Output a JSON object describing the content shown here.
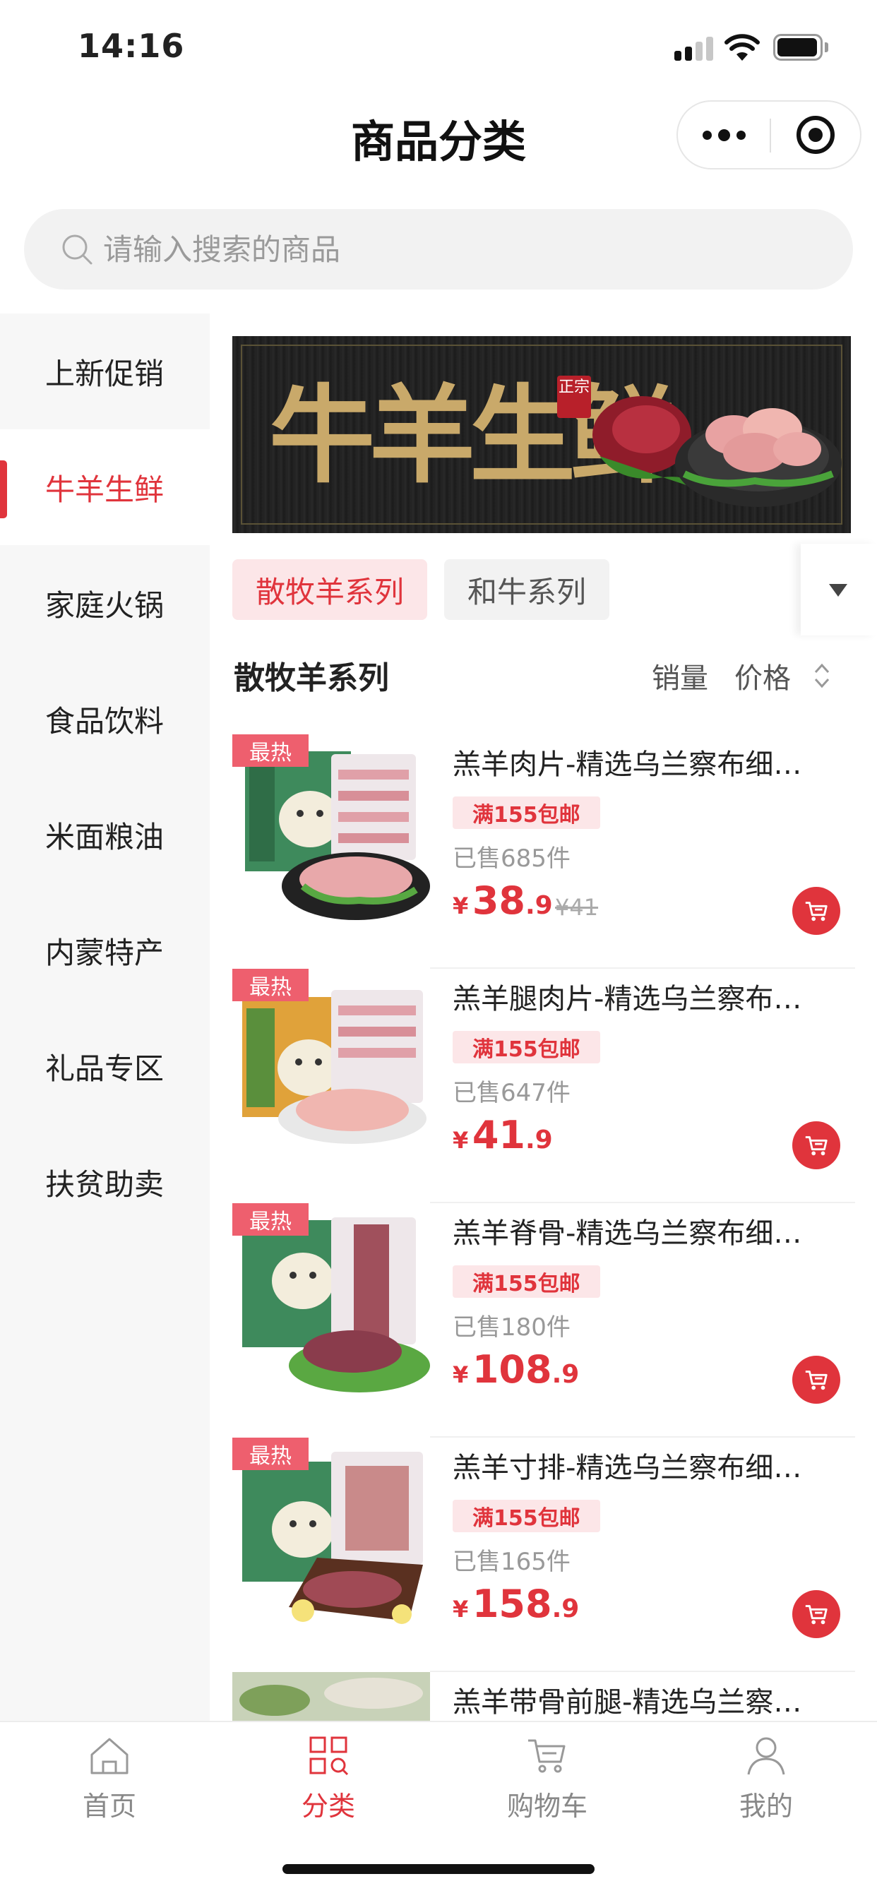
{
  "status_bar": {
    "time": "14:16"
  },
  "header": {
    "title": "商品分类"
  },
  "search": {
    "placeholder": "请输入搜索的商品"
  },
  "sidebar": {
    "items": [
      {
        "label": "上新促销",
        "active": false
      },
      {
        "label": "牛羊生鲜",
        "active": true
      },
      {
        "label": "家庭火锅",
        "active": false
      },
      {
        "label": "食品饮料",
        "active": false
      },
      {
        "label": "米面粮油",
        "active": false
      },
      {
        "label": "内蒙特产",
        "active": false
      },
      {
        "label": "礼品专区",
        "active": false
      },
      {
        "label": "扶贫助卖",
        "active": false
      }
    ]
  },
  "banner": {
    "title": "牛羊生鲜",
    "seal": "正宗"
  },
  "tabs": [
    {
      "label": "散牧羊系列",
      "active": true
    },
    {
      "label": "和牛系列",
      "active": false
    }
  ],
  "section": {
    "title": "散牧羊系列",
    "sort_sales": "销量",
    "sort_price": "价格"
  },
  "products": [
    {
      "badge": "最热",
      "name": "羔羊肉片-精选乌兰察布细…",
      "tag": "满155包邮",
      "sold": "已售685件",
      "currency": "¥",
      "price_int": "38",
      "price_dec": ".9",
      "orig_price": "¥41"
    },
    {
      "badge": "最热",
      "name": "羔羊腿肉片-精选乌兰察布…",
      "tag": "满155包邮",
      "sold": "已售647件",
      "currency": "¥",
      "price_int": "41",
      "price_dec": ".9",
      "orig_price": ""
    },
    {
      "badge": "最热",
      "name": "羔羊脊骨-精选乌兰察布细…",
      "tag": "满155包邮",
      "sold": "已售180件",
      "currency": "¥",
      "price_int": "108",
      "price_dec": ".9",
      "orig_price": ""
    },
    {
      "badge": "最热",
      "name": "羔羊寸排-精选乌兰察布细…",
      "tag": "满155包邮",
      "sold": "已售165件",
      "currency": "¥",
      "price_int": "158",
      "price_dec": ".9",
      "orig_price": ""
    },
    {
      "badge": "",
      "name": "羔羊带骨前腿-精选乌兰察…",
      "tag": "",
      "sold": "",
      "currency": "",
      "price_int": "",
      "price_dec": "",
      "orig_price": ""
    }
  ],
  "tabbar": [
    {
      "label": "首页",
      "icon": "home-icon",
      "active": false
    },
    {
      "label": "分类",
      "icon": "category-icon",
      "active": true
    },
    {
      "label": "购物车",
      "icon": "cart-icon",
      "active": false
    },
    {
      "label": "我的",
      "icon": "user-icon",
      "active": false
    }
  ],
  "colors": {
    "accent": "#e0343c",
    "badge": "#ee5f6e",
    "tag_bg": "#fce6e8"
  }
}
